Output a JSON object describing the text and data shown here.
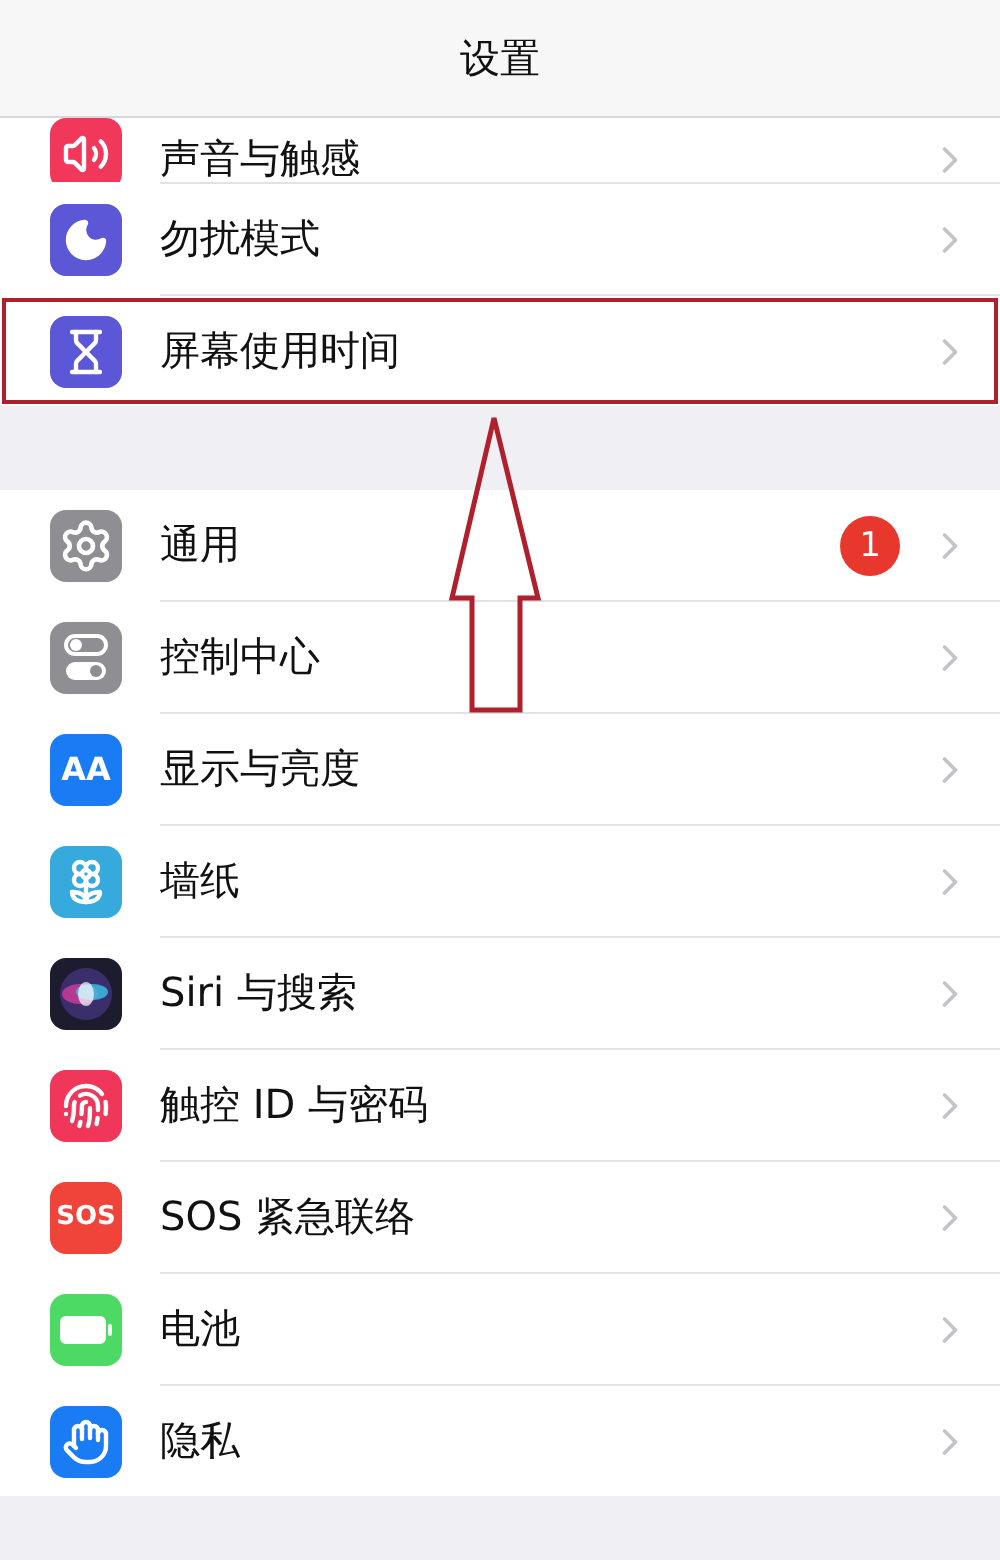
{
  "header": {
    "title": "设置"
  },
  "sections": [
    {
      "items": [
        {
          "label": "声音与触感",
          "kind": "sound",
          "color": "#f2385a",
          "partial": true,
          "highlighted": false
        },
        {
          "label": "勿扰模式",
          "kind": "moon",
          "color": "#5b57d6",
          "partial": false,
          "highlighted": false
        },
        {
          "label": "屏幕使用时间",
          "kind": "hourglass",
          "color": "#5b57d6",
          "partial": false,
          "highlighted": true
        }
      ]
    },
    {
      "items": [
        {
          "label": "通用",
          "kind": "gear",
          "color": "#8e8e93",
          "badge": "1",
          "partial": false,
          "highlighted": false
        },
        {
          "label": "控制中心",
          "kind": "toggles",
          "color": "#8e8e93",
          "partial": false,
          "highlighted": false
        },
        {
          "label": "显示与亮度",
          "kind": "letters",
          "icon_text": "AA",
          "color": "#1a7cf5",
          "partial": false,
          "highlighted": false
        },
        {
          "label": "墙纸",
          "kind": "flower",
          "color": "#36aadc",
          "partial": false,
          "highlighted": false
        },
        {
          "label": "Siri 与搜索",
          "kind": "siri",
          "color": "#1c1c2e",
          "partial": false,
          "highlighted": false
        },
        {
          "label": "触控 ID 与密码",
          "kind": "fingerprint",
          "color": "#f0375a",
          "partial": false,
          "highlighted": false
        },
        {
          "label": "SOS 紧急联络",
          "kind": "letters",
          "icon_text": "SOS",
          "color": "#f0443a",
          "partial": false,
          "highlighted": false
        },
        {
          "label": "电池",
          "kind": "battery",
          "color": "#4cd964",
          "partial": false,
          "highlighted": false
        },
        {
          "label": "隐私",
          "kind": "hand",
          "color": "#1a7cf5",
          "partial": false,
          "highlighted": false
        }
      ]
    }
  ],
  "annotation": {
    "kind": "arrow-up",
    "color": "#b0202c"
  }
}
